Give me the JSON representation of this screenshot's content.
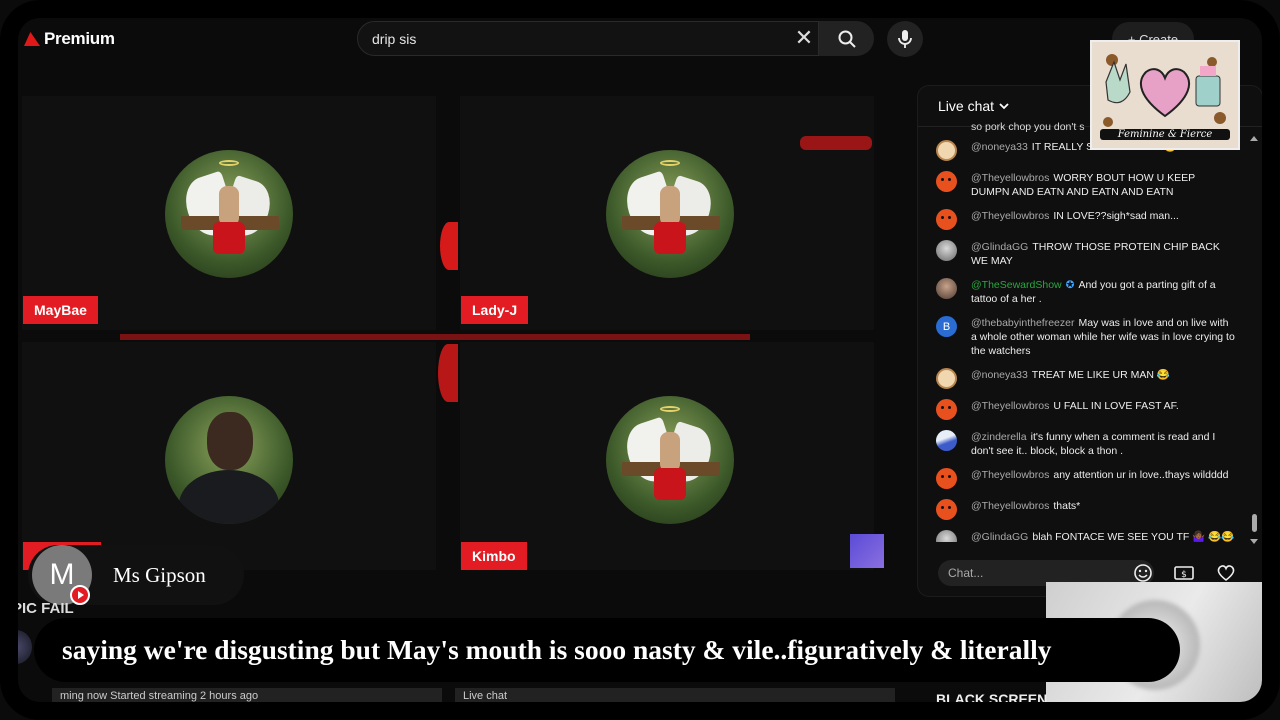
{
  "header": {
    "logo_text": "Premium",
    "search_value": "drip sis",
    "create_label": "+ Create"
  },
  "tiles": [
    {
      "name": "MayBae"
    },
    {
      "name": "Lady-J"
    },
    {
      "name": ""
    },
    {
      "name": "Kimbo"
    }
  ],
  "chat": {
    "title": "Live chat",
    "input_placeholder": "Chat...",
    "messages": [
      {
        "author": "",
        "text": "so pork chop you don't s"
      },
      {
        "author": "@noneya33",
        "text": "IT REALLY SEEMS GREAT 😂"
      },
      {
        "author": "@Theyellowbros",
        "text": "WORRY BOUT HOW U KEEP DUMPN AND EATN AND EATN AND EATN"
      },
      {
        "author": "@Theyellowbros",
        "text": "IN LOVE??sigh*sad man..."
      },
      {
        "author": "@GlindaGG",
        "text": "THROW THOSE PROTEIN CHIP BACK WE MAY"
      },
      {
        "author": "@TheSewardShow",
        "text": "And you got a parting gift of a tattoo of a her ."
      },
      {
        "author": "@thebabyinthefreezer",
        "text": "May was in love and on live with a whole other woman while her wife was in love crying to the watchers"
      },
      {
        "author": "@noneya33",
        "text": "TREAT ME LIKE UR MAN 😂"
      },
      {
        "author": "@Theyellowbros",
        "text": "U FALL IN LOVE FAST AF."
      },
      {
        "author": "@zinderella",
        "text": "it's funny when a comment is read and I don't see it.. block, block a thon ."
      },
      {
        "author": "@Theyellowbros",
        "text": "any attention ur in love..thays wildddd"
      },
      {
        "author": "@Theyellowbros",
        "text": "thats*"
      },
      {
        "author": "@GlindaGG",
        "text": "blah FONTACE WE SEE YOU TF 🤷🏾‍♀️ 😂😂"
      }
    ]
  },
  "overlay": {
    "viewer_initial": "M",
    "viewer_name": "Ms Gipson",
    "epic_label": "EPIC FAIL",
    "caption": "saying we're disgusting but May's mouth is sooo nasty & vile..figuratively & literally",
    "stream_status": "ming now  Started streaming 2 hours ago",
    "live_chat_tab": "Live chat",
    "black_screen_label": "BLACK SCREEN",
    "sticker_text": "Feminine & Fierce"
  },
  "colors": {
    "brand_red": "#e31b23",
    "panel_bg": "#0f0f0f",
    "accent_green": "#2ba640"
  }
}
